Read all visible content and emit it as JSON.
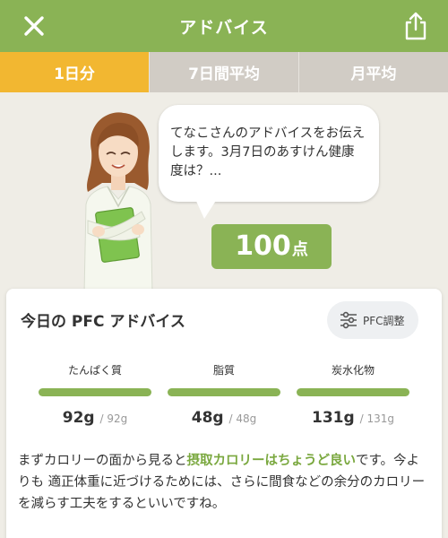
{
  "header": {
    "title": "アドバイス",
    "close_icon": "close-icon",
    "share_icon": "share-icon"
  },
  "tabs": [
    {
      "label": "1日分",
      "active": true
    },
    {
      "label": "7日間平均",
      "active": false
    },
    {
      "label": "月平均",
      "active": false
    }
  ],
  "message": "てなこさんのアドバイスをお伝えします。3月7日のあすけん健康度は？...",
  "score": {
    "value": "100",
    "unit": "点"
  },
  "pfc": {
    "title": "今日の PFC アドバイス",
    "adjust_label": "PFC調整",
    "adjust_icon": "sliders-icon",
    "nutrients": [
      {
        "name": "たんぱく質",
        "value": "92g",
        "target": "92g",
        "progress": 1.0
      },
      {
        "name": "脂質",
        "value": "48g",
        "target": "48g",
        "progress": 1.0
      },
      {
        "name": "炭水化物",
        "value": "131g",
        "target": "131g",
        "progress": 1.0
      }
    ]
  },
  "advice": {
    "before": "まずカロリーの面から見ると",
    "highlight": "摂取カロリーはちょうど良い",
    "after": "です。今よりも 適正体重に近づけるためには、さらに間食などの余分のカロリーを減らす工夫をするといいですね。"
  },
  "colors": {
    "accent_green": "#8ab355",
    "tab_active": "#f2b731",
    "tab_inactive": "#d1ccc5",
    "highlight_text": "#7aa83f"
  }
}
